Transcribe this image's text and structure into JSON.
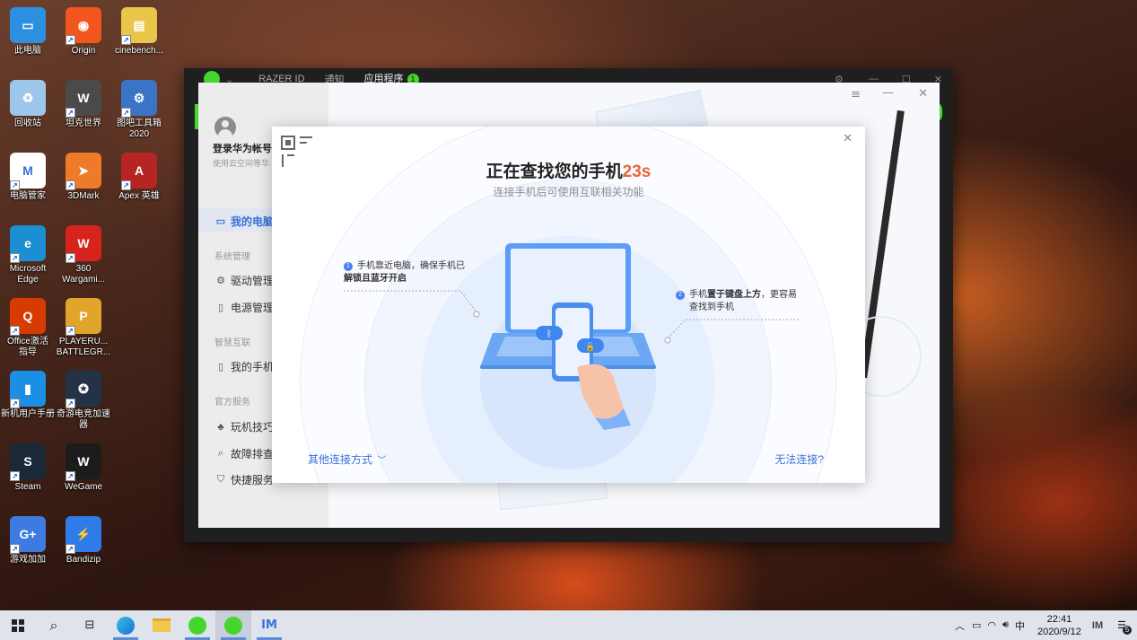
{
  "desktop_icons": [
    {
      "label": "此电脑",
      "color": "#2c8fe0",
      "glyph": "▭"
    },
    {
      "label": "Origin",
      "color": "#f0561d",
      "glyph": "◉"
    },
    {
      "label": "cinebench...",
      "color": "#e9c64a",
      "glyph": "▤"
    },
    {
      "label": "回收站",
      "color": "#9cc7ea",
      "glyph": "♻"
    },
    {
      "label": "坦克世界",
      "color": "#4a4a4a",
      "glyph": "W"
    },
    {
      "label": "图吧工具箱\n2020",
      "color": "#3b74c7",
      "glyph": "⚙"
    },
    {
      "label": "电脑管家",
      "color": "#ffffff",
      "glyph": "M"
    },
    {
      "label": "3DMark",
      "color": "#ef7a2a",
      "glyph": "➤"
    },
    {
      "label": "Apex 英雄",
      "color": "#b72424",
      "glyph": "A"
    },
    {
      "label": "Microsoft\nEdge",
      "color": "#1b8fd1",
      "glyph": "e"
    },
    {
      "label": "360\nWargami...",
      "color": "#d6231c",
      "glyph": "W"
    },
    {
      "label": "Office激活\n指导",
      "color": "#d83b01",
      "glyph": "Q"
    },
    {
      "label": "PLAYERU...\nBATTLEGR...",
      "color": "#e2a52b",
      "glyph": "P"
    },
    {
      "label": "新机用户手册",
      "color": "#1a8fe3",
      "glyph": "▮"
    },
    {
      "label": "奇游电竞加速\n器",
      "color": "#233247",
      "glyph": "✪"
    },
    {
      "label": "Steam",
      "color": "#1b2838",
      "glyph": "S"
    },
    {
      "label": "WeGame",
      "color": "#1c1c1c",
      "glyph": "W"
    },
    {
      "label": "游戏加加",
      "color": "#3d7be0",
      "glyph": "G+"
    },
    {
      "label": "Bandizip",
      "color": "#2f7be8",
      "glyph": "⚡"
    }
  ],
  "razer": {
    "tabs": [
      "RAZER ID",
      "通知",
      "应用程序"
    ],
    "apps_badge": "1"
  },
  "huawei": {
    "account_title": "登录华为帐号",
    "account_sub": "使用云空间等华",
    "my_pc": "我的电脑",
    "section_system": "系统管理",
    "driver": "驱动管理",
    "power": "电源管理",
    "section_smart": "智慧互联",
    "my_phone": "我的手机",
    "section_service": "官方服务",
    "tips": "玩机技巧",
    "troubleshoot": "故障排查",
    "quick_service": "快捷服务"
  },
  "dialog": {
    "title": "正在查找您的手机",
    "countdown": "23s",
    "subtitle": "连接手机后可使用互联相关功能",
    "hint1_num": "1",
    "hint1_line1": "手机靠近电脑，确保手机已",
    "hint1_line2": "解锁且蓝牙开启",
    "hint2_num": "2",
    "hint2_line1_a": "手机",
    "hint2_line1_b": "置于键盘上方",
    "hint2_line1_c": "，更容易",
    "hint2_line2": "查找到手机",
    "other_methods": "其他连接方式",
    "cannot_connect": "无法连接?"
  },
  "taskbar": {
    "time": "22:41",
    "date": "2020/9/12",
    "ime": "中",
    "notif_count": "5"
  },
  "colors": {
    "accent": "#3a71d9",
    "countdown": "#e8673a",
    "razer_green": "#44d62c"
  }
}
